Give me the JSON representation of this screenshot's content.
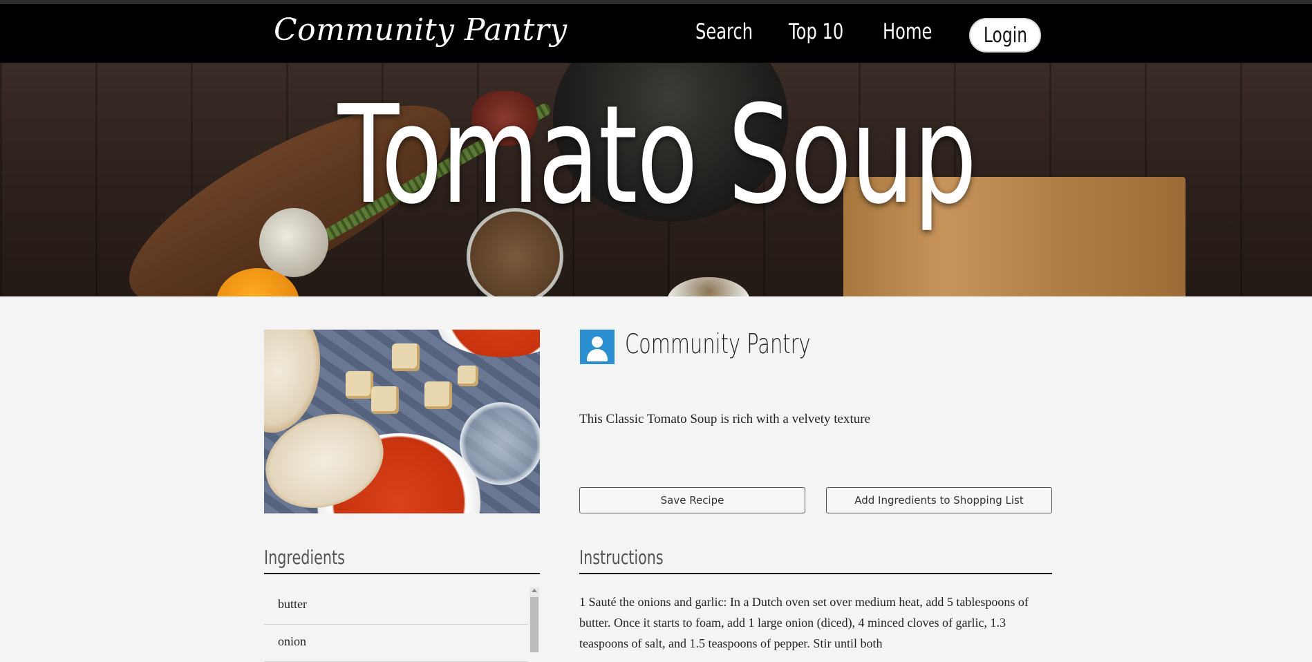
{
  "nav": {
    "brand": "Community Pantry",
    "links": {
      "search": "Search",
      "top10": "Top 10",
      "home": "Home"
    },
    "login": "Login"
  },
  "hero": {
    "title": "Tomato Soup"
  },
  "recipe": {
    "author": "Community Pantry",
    "description": "This Classic Tomato Soup is rich with a velvety texture",
    "buttons": {
      "save": "Save Recipe",
      "add_to_list": "Add Ingredients to Shopping List"
    }
  },
  "ingredients": {
    "heading": "Ingredients",
    "items": [
      "butter",
      "onion"
    ]
  },
  "instructions": {
    "heading": "Instructions",
    "text": "1 Sauté the onions and garlic: In a Dutch oven set over medium heat, add 5 tablespoons of butter. Once it starts to foam, add 1 large onion (diced), 4 minced cloves of garlic, 1.3 teaspoons of salt, and 1.5 teaspoons of pepper. Stir until both"
  },
  "colors": {
    "navbar": "#000000",
    "avatar": "#2a8ed1",
    "page_background": "#f4f4f4"
  }
}
